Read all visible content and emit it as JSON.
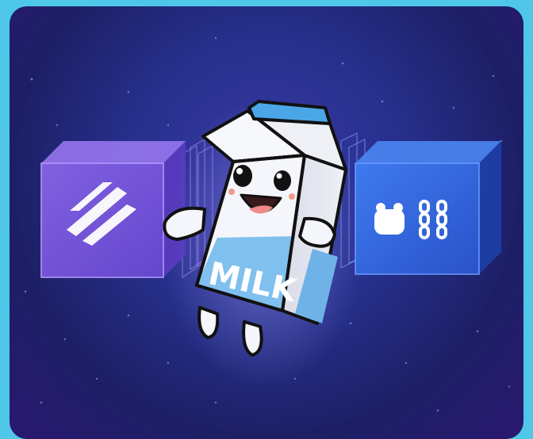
{
  "illustration": {
    "mascot_text": "MILK",
    "left_cube_logo": "stripe-bars-logo",
    "right_cube_logo": "paw-chain-logo",
    "colors": {
      "frame": "#4fc7e8",
      "background_dark": "#1d1f66",
      "left_cube": "#7a5ae0",
      "right_cube": "#2f63d8",
      "carton_blue": "#7fc0ee",
      "carton_white": "#f4f6fb",
      "cap_blue": "#4aa6e6"
    }
  }
}
